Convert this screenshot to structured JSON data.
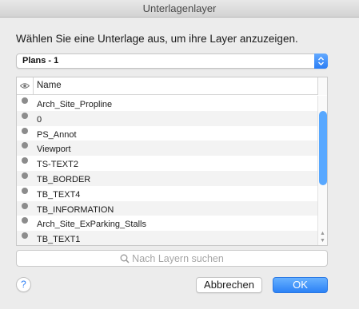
{
  "window": {
    "title": "Unterlagenlayer"
  },
  "prompt": "Wählen Sie eine Unterlage aus, um ihre Layer anzuzeigen.",
  "underlay_select": {
    "value": "Plans - 1"
  },
  "table": {
    "header_name": "Name",
    "rows": [
      {
        "label": "Arch_Site_Propline"
      },
      {
        "label": "0"
      },
      {
        "label": "PS_Annot"
      },
      {
        "label": "Viewport"
      },
      {
        "label": "TS-TEXT2"
      },
      {
        "label": "TB_BORDER"
      },
      {
        "label": "TB_TEXT4"
      },
      {
        "label": "TB_INFORMATION"
      },
      {
        "label": "Arch_Site_ExParking_Stalls"
      },
      {
        "label": "TB_TEXT1"
      }
    ]
  },
  "search": {
    "placeholder": "Nach Layern suchen"
  },
  "buttons": {
    "help": "?",
    "cancel": "Abbrechen",
    "ok": "OK"
  },
  "colors": {
    "accent": "#2c82f6",
    "visibility_dot": "#8c8c8c"
  }
}
